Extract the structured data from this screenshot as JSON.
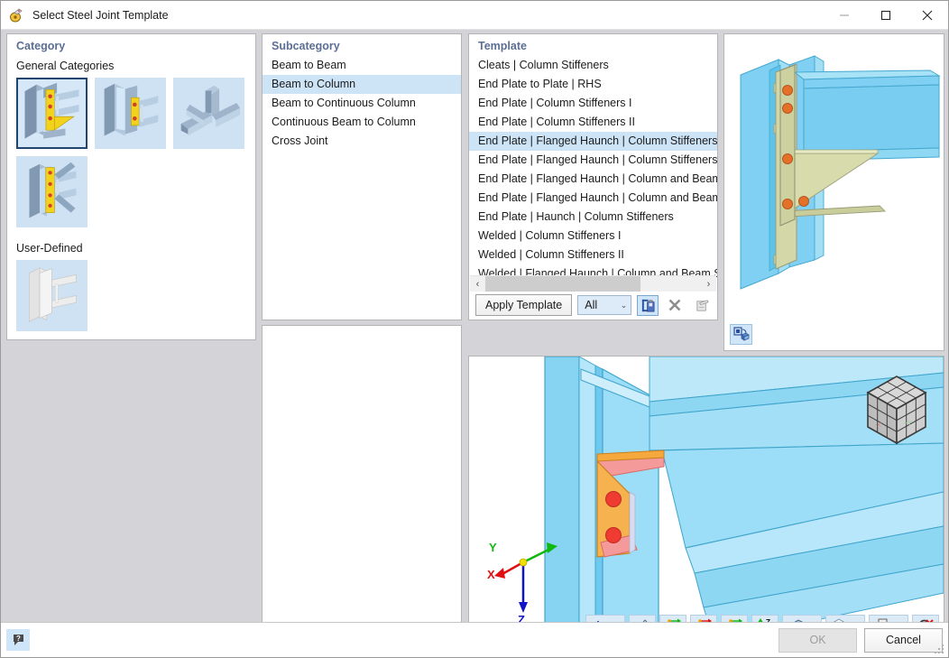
{
  "window": {
    "title": "Select Steel Joint Template",
    "icon": "steel-joint-app-icon",
    "minimize_label": "—",
    "maximize_label": "☐",
    "close_label": "✕"
  },
  "category": {
    "panel_title": "Category",
    "general_label": "General Categories",
    "user_defined_label": "User-Defined",
    "general_items": [
      {
        "name": "beam-to-column-haunch-thumb",
        "selected": true
      },
      {
        "name": "beam-to-beam-endplate-thumb",
        "selected": false
      },
      {
        "name": "cross-joint-hollow-section-thumb",
        "selected": false
      },
      {
        "name": "braced-column-joint-thumb",
        "selected": false
      }
    ],
    "user_defined_items": [
      {
        "name": "user-defined-empty-thumb",
        "selected": false
      }
    ]
  },
  "subcategory": {
    "panel_title": "Subcategory",
    "items": [
      {
        "label": "Beam to Beam",
        "selected": false
      },
      {
        "label": "Beam to Column",
        "selected": true
      },
      {
        "label": "Beam to Continuous Column",
        "selected": false
      },
      {
        "label": "Continuous Beam to Column",
        "selected": false
      },
      {
        "label": "Cross Joint",
        "selected": false
      }
    ]
  },
  "template": {
    "panel_title": "Template",
    "items": [
      {
        "label": "Cleats | Column Stiffeners",
        "selected": false
      },
      {
        "label": "End Plate to Plate | RHS",
        "selected": false
      },
      {
        "label": "End Plate | Column Stiffeners I",
        "selected": false
      },
      {
        "label": "End Plate | Column Stiffeners II",
        "selected": false
      },
      {
        "label": "End Plate | Flanged Haunch | Column Stiffeners I",
        "selected": true
      },
      {
        "label": "End Plate | Flanged Haunch | Column Stiffeners II",
        "selected": false
      },
      {
        "label": "End Plate | Flanged Haunch | Column and Beam Stiff",
        "selected": false
      },
      {
        "label": "End Plate | Flanged Haunch | Column and Beam Stiff",
        "selected": false
      },
      {
        "label": "End Plate | Haunch | Column Stiffeners",
        "selected": false
      },
      {
        "label": "Welded | Column Stiffeners I",
        "selected": false
      },
      {
        "label": "Welded | Column Stiffeners II",
        "selected": false
      },
      {
        "label": "Welded | Flanged Haunch | Column and Beam Stiffe",
        "selected": false
      }
    ],
    "scroll": {
      "left_arrow": "‹",
      "right_arrow": "›"
    },
    "toolbar": {
      "apply_label": "Apply Template",
      "filter_value": "All",
      "filter_chevron": "⌄",
      "save_icon": "save-template-icon",
      "delete_icon": "delete-template-icon",
      "rename_icon": "rename-template-icon"
    }
  },
  "preview": {
    "name": "joint-preview-3d",
    "render_mode_icon": "render-mode-icon"
  },
  "viewport": {
    "name": "joint-viewport-3d",
    "axes": {
      "x": "X",
      "y": "Y",
      "z": "Z"
    },
    "nav_cube": "view-cube",
    "toolbar": [
      {
        "name": "coordinate-system-button",
        "icon": "axes-icon",
        "has_caret": true
      },
      {
        "name": "measure-button",
        "icon": "ruler-protractor-icon",
        "has_caret": false
      },
      {
        "name": "view-in-x-button",
        "icon": "axis-x-icon",
        "label": "X",
        "has_caret": false
      },
      {
        "name": "view-in-negative-y-button",
        "icon": "axis-negative-y-icon",
        "label": "-Y",
        "has_caret": false
      },
      {
        "name": "view-in-z-button",
        "icon": "axis-z-icon",
        "label": "Z",
        "has_caret": false
      },
      {
        "name": "view-in-negative-z-button",
        "icon": "axis-negative-z-icon",
        "label": "-Z",
        "has_caret": false
      },
      {
        "name": "render-style-button",
        "icon": "solid-box-icon",
        "has_caret": true
      },
      {
        "name": "wireframe-button",
        "icon": "wireframe-cube-icon",
        "has_caret": true
      },
      {
        "name": "print-button",
        "icon": "printer-icon",
        "has_caret": true
      },
      {
        "name": "reset-view-button",
        "icon": "zoom-reset-icon",
        "has_caret": false
      }
    ]
  },
  "footer": {
    "help_icon": "help-question-icon",
    "ok_label": "OK",
    "ok_disabled": true,
    "cancel_label": "Cancel"
  },
  "colors": {
    "accent": "#5b6e94",
    "selection": "#cde4f7",
    "panel_bg": "#ffffff",
    "window_bg": "#d4d4d8",
    "steel_blue": "#76c7ee",
    "plate_yellow": "#f5a83c",
    "bolt_red": "#e8463c"
  }
}
